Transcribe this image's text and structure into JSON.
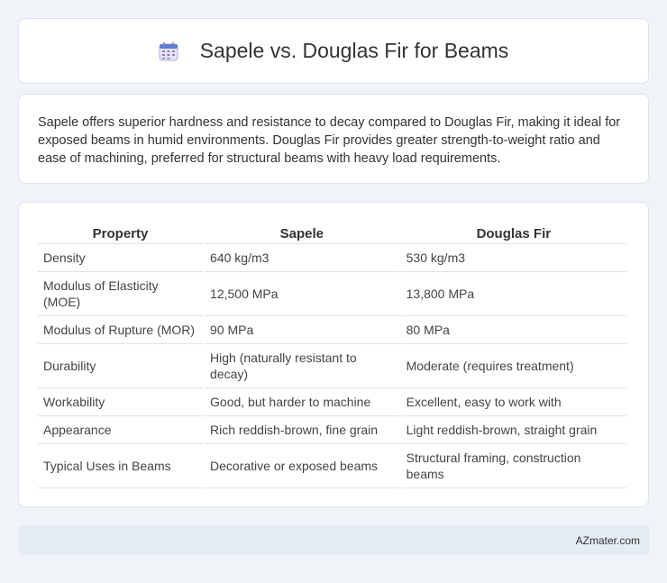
{
  "header": {
    "title": "Sapele vs. Douglas Fir for Beams",
    "icon": "calendar-icon"
  },
  "summary": {
    "text": "Sapele offers superior hardness and resistance to decay compared to Douglas Fir, making it ideal for exposed beams in humid environments. Douglas Fir provides greater strength-to-weight ratio and ease of machining, preferred for structural beams with heavy load requirements."
  },
  "table": {
    "headers": [
      "Property",
      "Sapele",
      "Douglas Fir"
    ],
    "rows": [
      [
        "Density",
        "640 kg/m3",
        "530 kg/m3"
      ],
      [
        "Modulus of Elasticity (MOE)",
        "12,500 MPa",
        "13,800 MPa"
      ],
      [
        "Modulus of Rupture (MOR)",
        "90 MPa",
        "80 MPa"
      ],
      [
        "Durability",
        "High (naturally resistant to decay)",
        "Moderate (requires treatment)"
      ],
      [
        "Workability",
        "Good, but harder to machine",
        "Excellent, easy to work with"
      ],
      [
        "Appearance",
        "Rich reddish-brown, fine grain",
        "Light reddish-brown, straight grain"
      ],
      [
        "Typical Uses in Beams",
        "Decorative or exposed beams",
        "Structural framing, construction beams"
      ]
    ]
  },
  "footer": {
    "brand": "AZmater.com"
  }
}
